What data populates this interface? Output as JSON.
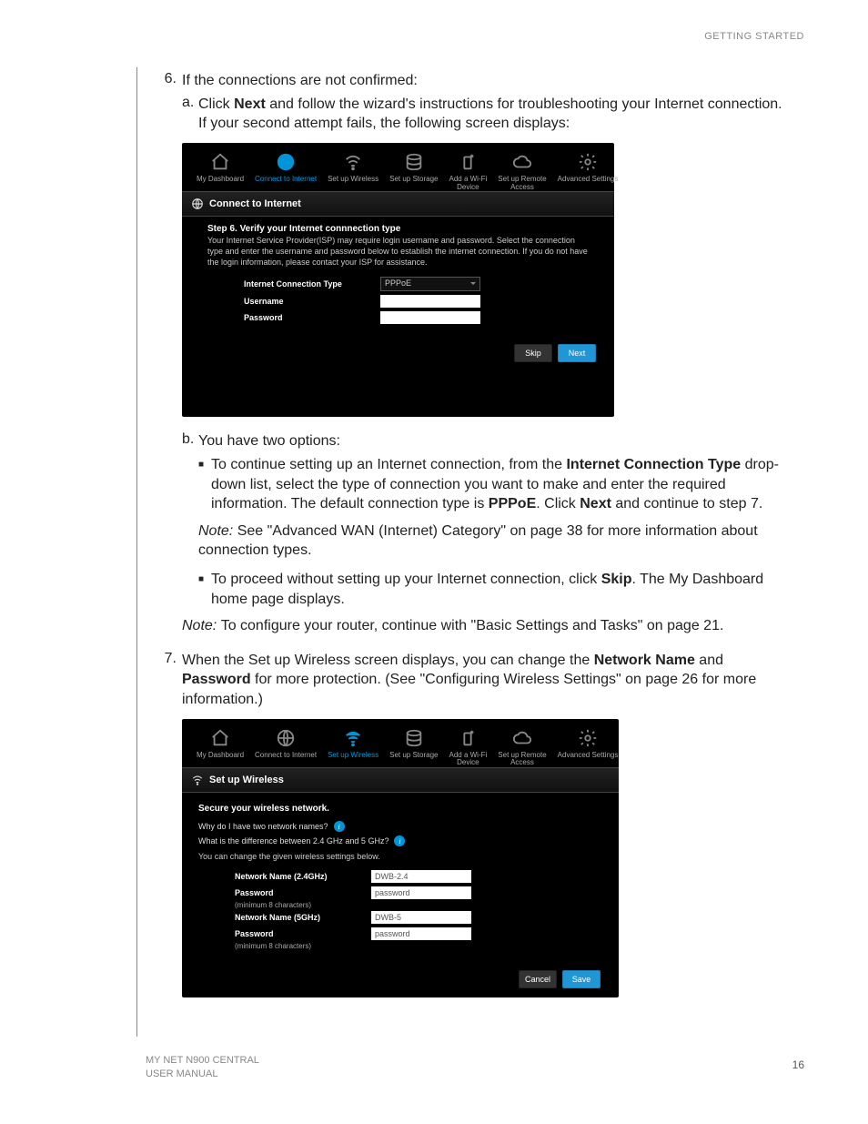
{
  "header": {
    "section": "GETTING STARTED"
  },
  "footer": {
    "product": "MY NET N900 CENTRAL",
    "manual": "USER MANUAL",
    "page": "16"
  },
  "step6": {
    "num": "6.",
    "intro": "If the connections are not confirmed:",
    "a": {
      "let": "a.",
      "pre": "Click ",
      "bold": "Next",
      "post": " and follow the wizard's instructions for troubleshooting your Internet connection. If your second attempt fails, the following screen displays:"
    },
    "b": {
      "let": "b.",
      "intro": "You have two options:",
      "bullet1": {
        "pre": "To continue setting up an Internet connection, from the ",
        "b1": "Internet Connection Type",
        "mid1": " drop-down list, select the type of connection you want to make and enter the required information. The default connection type is ",
        "b2": "PPPoE",
        "mid2": ". Click ",
        "b3": "Next",
        "post": " and continue to step 7."
      },
      "note1": {
        "label": "Note: ",
        "text": " See \"Advanced WAN (Internet) Category\" on page 38 for more information about connection types."
      },
      "bullet2": {
        "pre": "To proceed without setting up your Internet connection, click ",
        "b1": "Skip",
        "post": ". The My Dashboard home page displays."
      },
      "note2": {
        "label": "Note: ",
        "text": " To configure your router, continue with \"Basic Settings and Tasks\" on page 21."
      }
    }
  },
  "step7": {
    "num": "7.",
    "pre": "When the Set up Wireless screen displays, you can change the ",
    "b1": "Network Name",
    "mid": " and ",
    "b2": "Password",
    "post": " for more protection. (See \"Configuring Wireless Settings\" on page 26 for more information.)"
  },
  "shot1": {
    "nav": [
      "My Dashboard",
      "Connect to Internet",
      "Set up Wireless",
      "Set up Storage",
      "Add a Wi-Fi\nDevice",
      "Set up Remote\nAccess",
      "Advanced Settings"
    ],
    "section_title": "Connect to Internet",
    "step_title": "Step 6. Verify your Internet connnection type",
    "step_desc": "Your Internet Service Provider(ISP) may require login username and password. Select the connection type and enter the username and password below to establish the internet connection. If you do not have the login information, please contact your ISP for assistance.",
    "fields": {
      "conn_type_label": "Internet Connection Type",
      "conn_type_value": "PPPoE",
      "username_label": "Username",
      "password_label": "Password"
    },
    "buttons": {
      "skip": "Skip",
      "next": "Next"
    }
  },
  "shot2": {
    "nav": [
      "My Dashboard",
      "Connect to Internet",
      "Set up Wireless",
      "Set up Storage",
      "Add a Wi-Fi\nDevice",
      "Set up Remote\nAccess",
      "Advanced Settings"
    ],
    "section_title": "Set up Wireless",
    "subtitle": "Secure your wireless network.",
    "q1": "Why do I have two network names?",
    "q2": "What is the difference between 2.4 GHz and 5 GHz?",
    "change_note": "You can change the given wireless settings below.",
    "fields": {
      "name24_label": "Network Name (2.4GHz)",
      "name24_value": "DWB-2.4",
      "pass24_label": "Password",
      "pass24_value": "password",
      "min24": "(minimum 8 characters)",
      "name5_label": "Network Name (5GHz)",
      "name5_value": "DWB-5",
      "pass5_label": "Password",
      "pass5_value": "password",
      "min5": "(minimum 8 characters)"
    },
    "buttons": {
      "cancel": "Cancel",
      "save": "Save"
    }
  }
}
